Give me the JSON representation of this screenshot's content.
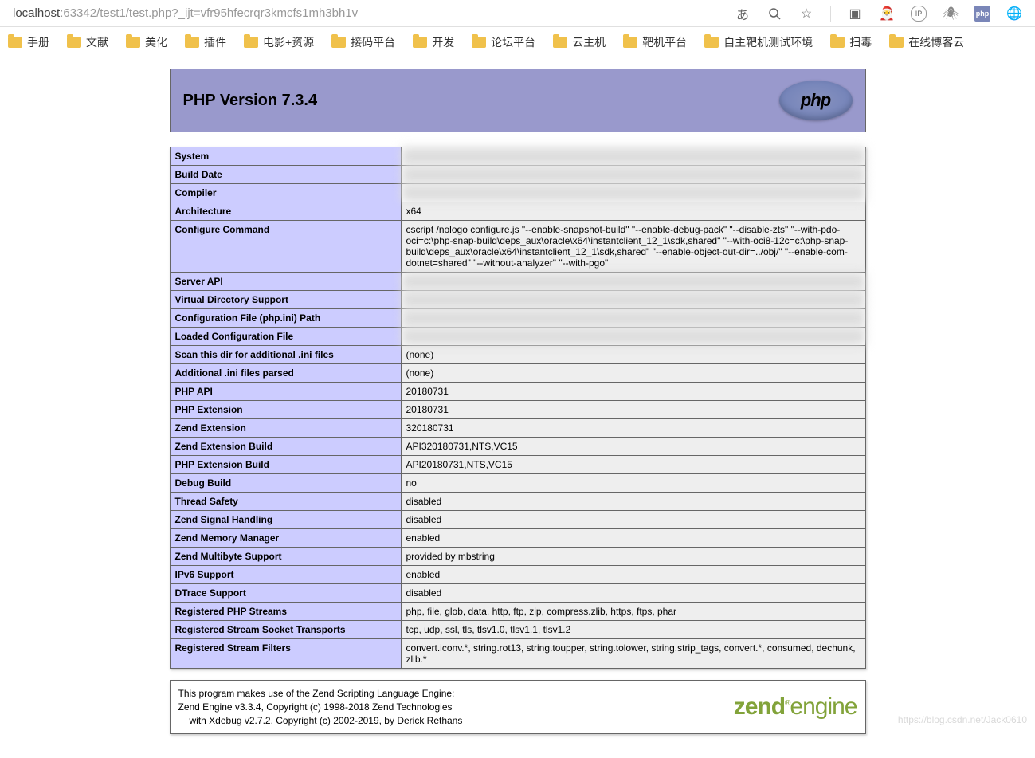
{
  "address": {
    "host": "localhost",
    "rest": ":63342/test1/test.php?_ijt=vfr95hfecrqr3kmcfs1mh3bh1v"
  },
  "toolbar_icons": [
    "translate-icon",
    "search-icon",
    "star-icon",
    "extension-icon-1",
    "extension-icon-2",
    "ip-icon",
    "spider-icon",
    "php-icon",
    "globe-icon"
  ],
  "bookmarks": [
    "手册",
    "文献",
    "美化",
    "插件",
    "电影+资源",
    "接码平台",
    "开发",
    "论坛平台",
    "云主机",
    "靶机平台",
    "自主靶机测试环境",
    "扫毒",
    "在线博客云"
  ],
  "header_title": "PHP Version 7.3.4",
  "php_logo_text": "php",
  "info_rows": [
    {
      "k": "System",
      "v": "",
      "blur": true
    },
    {
      "k": "Build Date",
      "v": "",
      "blur": true
    },
    {
      "k": "Compiler",
      "v": "",
      "blur": true
    },
    {
      "k": "Architecture",
      "v": "x64"
    },
    {
      "k": "Configure Command",
      "v": "cscript /nologo configure.js \"--enable-snapshot-build\" \"--enable-debug-pack\" \"--disable-zts\" \"--with-pdo-oci=c:\\php-snap-build\\deps_aux\\oracle\\x64\\instantclient_12_1\\sdk,shared\" \"--with-oci8-12c=c:\\php-snap-build\\deps_aux\\oracle\\x64\\instantclient_12_1\\sdk,shared\" \"--enable-object-out-dir=../obj/\" \"--enable-com-dotnet=shared\" \"--without-analyzer\" \"--with-pgo\""
    },
    {
      "k": "Server API",
      "v": "",
      "blur": true
    },
    {
      "k": "Virtual Directory Support",
      "v": "",
      "blur": true
    },
    {
      "k": "Configuration File (php.ini) Path",
      "v": "",
      "blur": true
    },
    {
      "k": "Loaded Configuration File",
      "v": "",
      "blur": true
    },
    {
      "k": "Scan this dir for additional .ini files",
      "v": "(none)"
    },
    {
      "k": "Additional .ini files parsed",
      "v": "(none)"
    },
    {
      "k": "PHP API",
      "v": "20180731"
    },
    {
      "k": "PHP Extension",
      "v": "20180731"
    },
    {
      "k": "Zend Extension",
      "v": "320180731"
    },
    {
      "k": "Zend Extension Build",
      "v": "API320180731,NTS,VC15"
    },
    {
      "k": "PHP Extension Build",
      "v": "API20180731,NTS,VC15"
    },
    {
      "k": "Debug Build",
      "v": "no"
    },
    {
      "k": "Thread Safety",
      "v": "disabled"
    },
    {
      "k": "Zend Signal Handling",
      "v": "disabled"
    },
    {
      "k": "Zend Memory Manager",
      "v": "enabled"
    },
    {
      "k": "Zend Multibyte Support",
      "v": "provided by mbstring"
    },
    {
      "k": "IPv6 Support",
      "v": "enabled"
    },
    {
      "k": "DTrace Support",
      "v": "disabled"
    },
    {
      "k": "Registered PHP Streams",
      "v": "php, file, glob, data, http, ftp, zip, compress.zlib, https, ftps, phar"
    },
    {
      "k": "Registered Stream Socket Transports",
      "v": "tcp, udp, ssl, tls, tlsv1.0, tlsv1.1, tlsv1.2"
    },
    {
      "k": "Registered Stream Filters",
      "v": "convert.iconv.*, string.rot13, string.toupper, string.tolower, string.strip_tags, convert.*, consumed, dechunk, zlib.*"
    }
  ],
  "zend": {
    "line1": "This program makes use of the Zend Scripting Language Engine:",
    "line2": "Zend Engine v3.3.4, Copyright (c) 1998-2018 Zend Technologies",
    "line3": "with Xdebug v2.7.2, Copyright (c) 2002-2019, by Derick Rethans",
    "logo_a": "zend",
    "logo_b": "engine"
  },
  "watermark": "https://blog.csdn.net/Jack0610"
}
